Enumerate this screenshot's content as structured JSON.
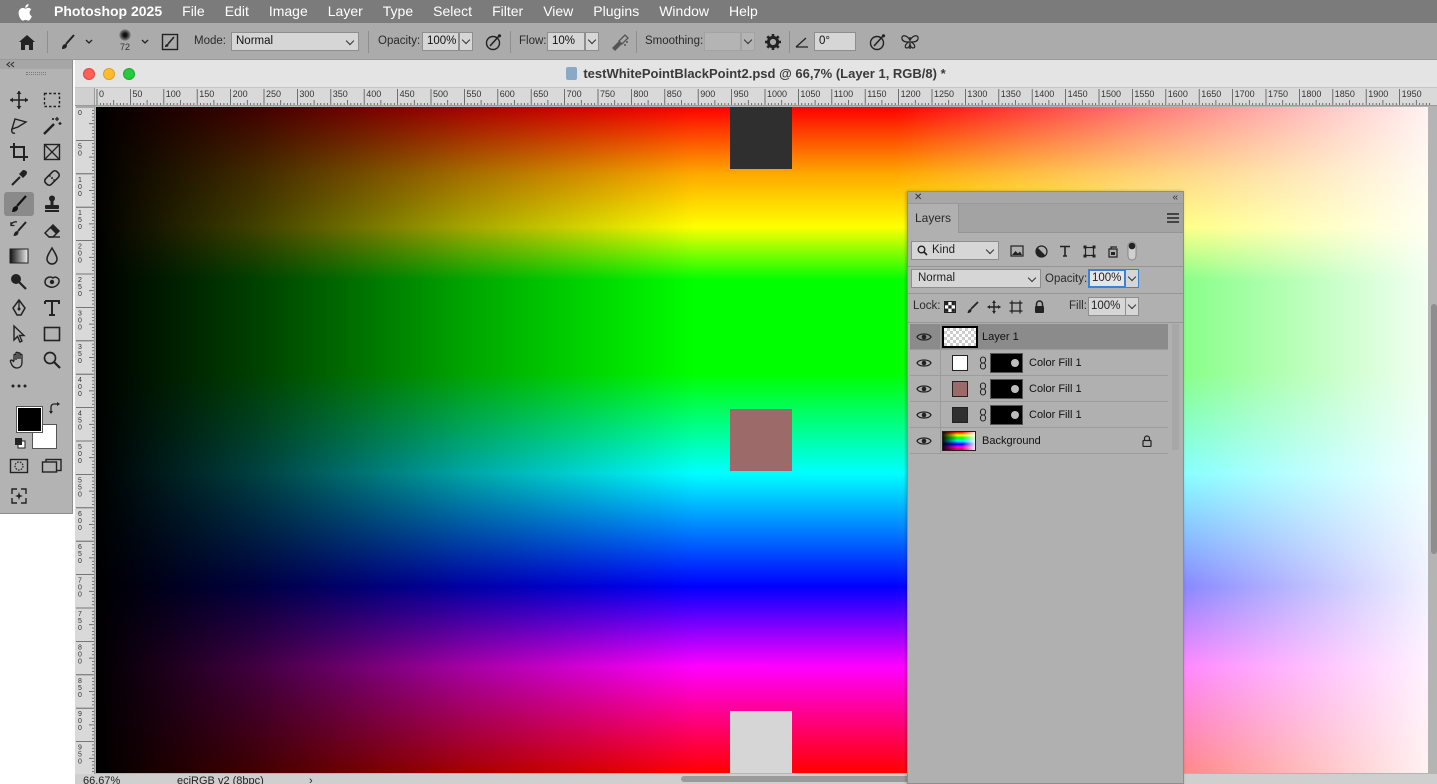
{
  "menubar": {
    "app_name": "Photoshop 2025",
    "items": [
      "File",
      "Edit",
      "Image",
      "Layer",
      "Type",
      "Select",
      "Filter",
      "View",
      "Plugins",
      "Window",
      "Help"
    ]
  },
  "options_bar": {
    "brush_size": "72",
    "mode_label": "Mode:",
    "mode_value": "Normal",
    "opacity_label": "Opacity:",
    "opacity_value": "100%",
    "flow_label": "Flow:",
    "flow_value": "10%",
    "smoothing_label": "Smoothing:",
    "smoothing_value": "",
    "angle_value": "0°"
  },
  "tools": {
    "active": "brush-tool",
    "foreground_color": "#000000",
    "background_color": "#ffffff"
  },
  "document": {
    "title": "testWhitePointBlackPoint2.psd @ 66,7% (Layer 1, RGB/8) *",
    "ruler_h_ticks": [
      "0",
      "50",
      "100",
      "150",
      "200",
      "250",
      "300",
      "350",
      "400",
      "450",
      "500",
      "550",
      "600",
      "650",
      "700",
      "750",
      "800",
      "850",
      "900",
      "950",
      "1000",
      "1050",
      "1100",
      "1150",
      "1200",
      "1250",
      "1300",
      "1350",
      "1400",
      "1450",
      "1500",
      "1550",
      "1600",
      "1650",
      "1700",
      "1750",
      "1800",
      "1850",
      "1900",
      "1950"
    ],
    "ruler_v_ticks": [
      "0",
      "50",
      "100",
      "150",
      "200",
      "250",
      "300",
      "350",
      "400",
      "450",
      "500",
      "550",
      "600",
      "650",
      "700",
      "750",
      "800",
      "850",
      "900",
      "950"
    ],
    "swatches": [
      "#2f2f2f",
      "#9c6b69",
      "#d6d6d6"
    ],
    "status_zoom": "66,67%",
    "status_profile": "eciRGB v2 (8bpc)",
    "status_arrow": "›"
  },
  "layers_panel": {
    "tab_label": "Layers",
    "filter_kind": "Kind",
    "blend_mode": "Normal",
    "opacity_label": "Opacity:",
    "opacity_value": "100%",
    "lock_label": "Lock:",
    "fill_label": "Fill:",
    "fill_value": "100%",
    "layers": [
      {
        "name": "Layer 1",
        "type": "pixel",
        "selected": true
      },
      {
        "name": "Color Fill 1",
        "type": "fill",
        "fill_color": "#ffffff"
      },
      {
        "name": "Color Fill 1",
        "type": "fill",
        "fill_color": "#9c6b69"
      },
      {
        "name": "Color Fill 1",
        "type": "fill",
        "fill_color": "#2f2f2f"
      },
      {
        "name": "Background",
        "type": "background",
        "locked": true
      }
    ]
  }
}
